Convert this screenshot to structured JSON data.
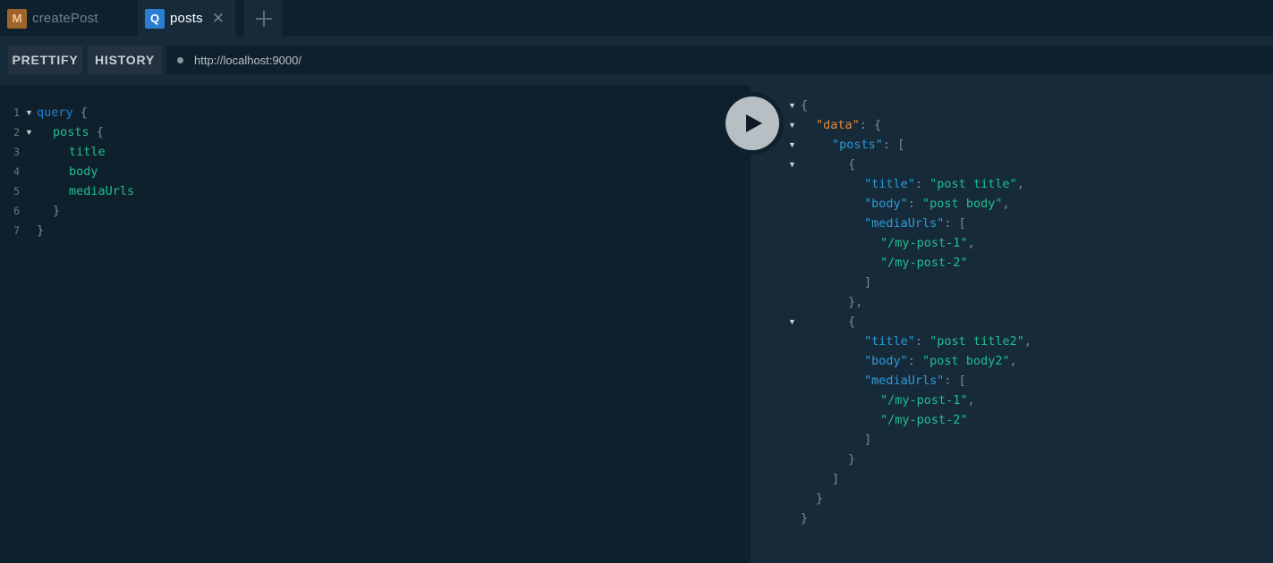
{
  "tabs": [
    {
      "badge": "M",
      "title": "createPost"
    },
    {
      "badge": "Q",
      "title": "posts",
      "close": "✕"
    }
  ],
  "toolbar": {
    "prettify_label": "PRETTIFY",
    "history_label": "HISTORY",
    "url": "http://localhost:9000/"
  },
  "query": {
    "line_numbers": [
      "1",
      "2",
      "3",
      "4",
      "5",
      "6",
      "7"
    ],
    "keyword": "query",
    "root_field": "posts",
    "fields": [
      "title",
      "body",
      "mediaUrls"
    ],
    "open_brace": "{",
    "close_brace": "}"
  },
  "result": {
    "key_data": "\"data\"",
    "key_posts": "\"posts\"",
    "key_title": "\"title\"",
    "key_body": "\"body\"",
    "key_media": "\"mediaUrls\"",
    "post1_title": "\"post title\"",
    "post1_body": "\"post body\"",
    "post2_title": "\"post title2\"",
    "post2_body": "\"post body2\"",
    "media1": "\"/my-post-1\"",
    "media2": "\"/my-post-2\""
  },
  "colors": {
    "background": "#172a3a",
    "editor_bg": "#0f202d",
    "keyword": "#2a7ed3",
    "field": "#1fbf8f",
    "string": "#1fbf8f",
    "json_key": "#2a9bd8",
    "data_key": "#e08a3a",
    "mutation_badge": "#a0642b",
    "query_badge": "#2a7ed3"
  },
  "icons": [
    "close-icon",
    "plus-icon",
    "play-icon",
    "fold-arrow-icon",
    "status-dot"
  ]
}
